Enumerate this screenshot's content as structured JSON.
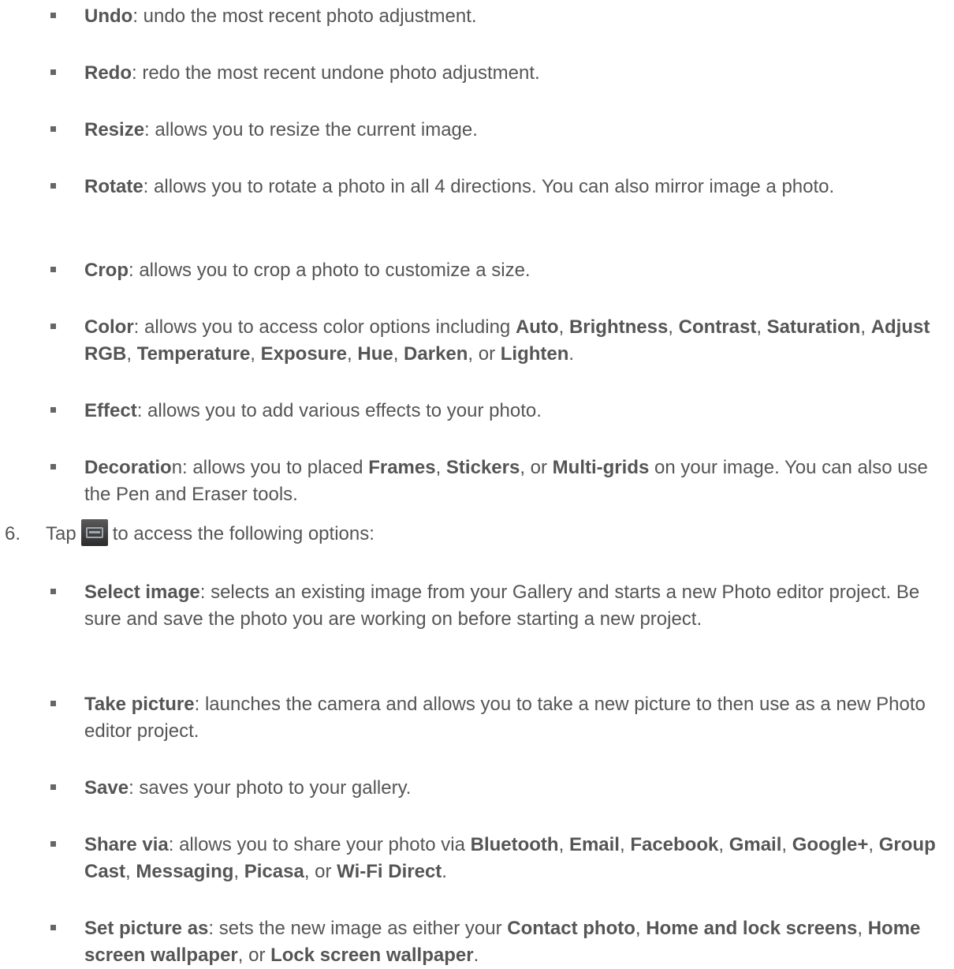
{
  "list_a": [
    {
      "parts": [
        {
          "t": "Undo",
          "b": true
        },
        {
          "t": ": undo the most recent photo adjustment.",
          "b": false
        }
      ]
    },
    {
      "parts": [
        {
          "t": "Redo",
          "b": true
        },
        {
          "t": ": redo the most recent undone photo adjustment.",
          "b": false
        }
      ]
    },
    {
      "parts": [
        {
          "t": "Resize",
          "b": true
        },
        {
          "t": ": allows you to resize the current image.",
          "b": false
        }
      ]
    },
    {
      "parts": [
        {
          "t": "Rotate",
          "b": true
        },
        {
          "t": ": allows you to rotate a photo in all 4 directions. You can also mirror image a photo.",
          "b": false
        }
      ]
    },
    {
      "parts": [
        {
          "t": "Crop",
          "b": true
        },
        {
          "t": ": allows you to crop a photo to customize a size.",
          "b": false
        }
      ]
    },
    {
      "parts": [
        {
          "t": "Color",
          "b": true
        },
        {
          "t": ": allows you to access color options including ",
          "b": false
        },
        {
          "t": "Auto",
          "b": true
        },
        {
          "t": ", ",
          "b": false
        },
        {
          "t": "Brightness",
          "b": true
        },
        {
          "t": ", ",
          "b": false
        },
        {
          "t": "Contrast",
          "b": true
        },
        {
          "t": ", ",
          "b": false
        },
        {
          "t": "Saturation",
          "b": true
        },
        {
          "t": ", ",
          "b": false
        },
        {
          "t": "Adjust RGB",
          "b": true
        },
        {
          "t": ", ",
          "b": false
        },
        {
          "t": "Temperature",
          "b": true
        },
        {
          "t": ", ",
          "b": false
        },
        {
          "t": "Exposure",
          "b": true
        },
        {
          "t": ", ",
          "b": false
        },
        {
          "t": "Hue",
          "b": true
        },
        {
          "t": ", ",
          "b": false
        },
        {
          "t": "Darken",
          "b": true
        },
        {
          "t": ", or ",
          "b": false
        },
        {
          "t": "Lighten",
          "b": true
        },
        {
          "t": ".",
          "b": false
        }
      ]
    },
    {
      "parts": [
        {
          "t": "Effect",
          "b": true
        },
        {
          "t": ": allows you to add various effects to your photo.",
          "b": false
        }
      ]
    },
    {
      "parts": [
        {
          "t": "Decoratio",
          "b": true
        },
        {
          "t": "n: allows you to placed ",
          "b": false
        },
        {
          "t": "Frames",
          "b": true
        },
        {
          "t": ", ",
          "b": false
        },
        {
          "t": "Stickers",
          "b": true
        },
        {
          "t": ", or ",
          "b": false
        },
        {
          "t": "Multi-grids",
          "b": true
        },
        {
          "t": " on your image. You can also use the Pen and Eraser tools.",
          "b": false
        }
      ]
    }
  ],
  "step": {
    "number": "6.",
    "before": "Tap",
    "after": "to access the following options:",
    "icon": "menu-icon"
  },
  "list_b": [
    {
      "parts": [
        {
          "t": "Select image",
          "b": true
        },
        {
          "t": ": selects an existing image from your Gallery and starts a new Photo editor project. Be sure and save the photo you are working on before starting a new project.",
          "b": false
        }
      ]
    },
    {
      "parts": [
        {
          "t": "Take picture",
          "b": true
        },
        {
          "t": ": launches the camera and allows you to take a new picture to then use as a new Photo editor project.",
          "b": false
        }
      ]
    },
    {
      "parts": [
        {
          "t": "Save",
          "b": true
        },
        {
          "t": ": saves your photo to your gallery.",
          "b": false
        }
      ]
    },
    {
      "parts": [
        {
          "t": "Share via",
          "b": true
        },
        {
          "t": ": allows you to share your photo via ",
          "b": false
        },
        {
          "t": "Bluetooth",
          "b": true
        },
        {
          "t": ", ",
          "b": false
        },
        {
          "t": "Email",
          "b": true
        },
        {
          "t": ", ",
          "b": false
        },
        {
          "t": "Facebook",
          "b": true
        },
        {
          "t": ", ",
          "b": false
        },
        {
          "t": "Gmail",
          "b": true
        },
        {
          "t": ", ",
          "b": false
        },
        {
          "t": "Google+",
          "b": true
        },
        {
          "t": ", ",
          "b": false
        },
        {
          "t": "Group Cast",
          "b": true
        },
        {
          "t": ", ",
          "b": false
        },
        {
          "t": "Messaging",
          "b": true
        },
        {
          "t": ", ",
          "b": false
        },
        {
          "t": "Picasa",
          "b": true
        },
        {
          "t": ", or ",
          "b": false
        },
        {
          "t": "Wi-Fi Direct",
          "b": true
        },
        {
          "t": ".",
          "b": false
        }
      ]
    },
    {
      "parts": [
        {
          "t": "Set picture as",
          "b": true
        },
        {
          "t": ": sets the new image as either your ",
          "b": false
        },
        {
          "t": "Contact photo",
          "b": true
        },
        {
          "t": ", ",
          "b": false
        },
        {
          "t": "Home and lock screens",
          "b": true
        },
        {
          "t": ", ",
          "b": false
        },
        {
          "t": "Home screen wallpaper",
          "b": true
        },
        {
          "t": ", or ",
          "b": false
        },
        {
          "t": "Lock screen wallpaper",
          "b": true
        },
        {
          "t": ".",
          "b": false
        }
      ]
    }
  ]
}
